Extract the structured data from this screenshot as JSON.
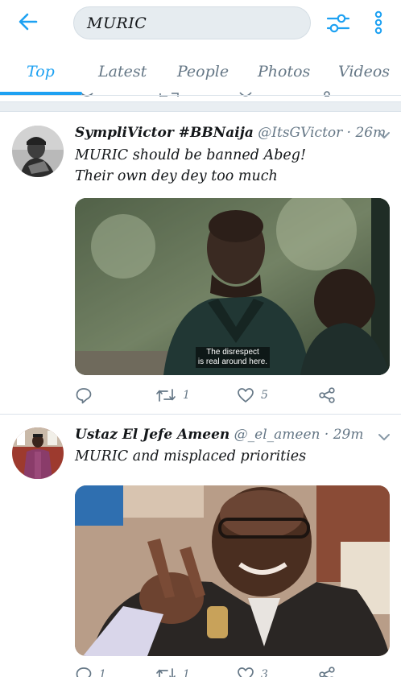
{
  "header": {
    "back_icon": "arrow-left-icon",
    "search_value": "MURIC",
    "filter_icon": "sliders-icon",
    "more_icon": "more-vertical-icon",
    "accent": "#1da1f2"
  },
  "tabs": [
    {
      "label": "Top",
      "active": true
    },
    {
      "label": "Latest",
      "active": false
    },
    {
      "label": "People",
      "active": false
    },
    {
      "label": "Photos",
      "active": false
    },
    {
      "label": "Videos",
      "active": false
    }
  ],
  "tweets": [
    {
      "name": "SympliVictor #BBNaija",
      "handle": "@ItsGVictor",
      "time": "26m",
      "text": "MURIC should be banned Abeg!\nTheir own dey dey too much",
      "media_caption": "The disrespect\nis real around here.",
      "reply_count": "",
      "retweet_count": "1",
      "like_count": "5"
    },
    {
      "name": "Ustaz El Jefe Ameen",
      "handle": "@_el_ameen",
      "time": "29m",
      "text": "MURIC and misplaced priorities",
      "reply_count": "1",
      "retweet_count": "1",
      "like_count": "3"
    }
  ]
}
